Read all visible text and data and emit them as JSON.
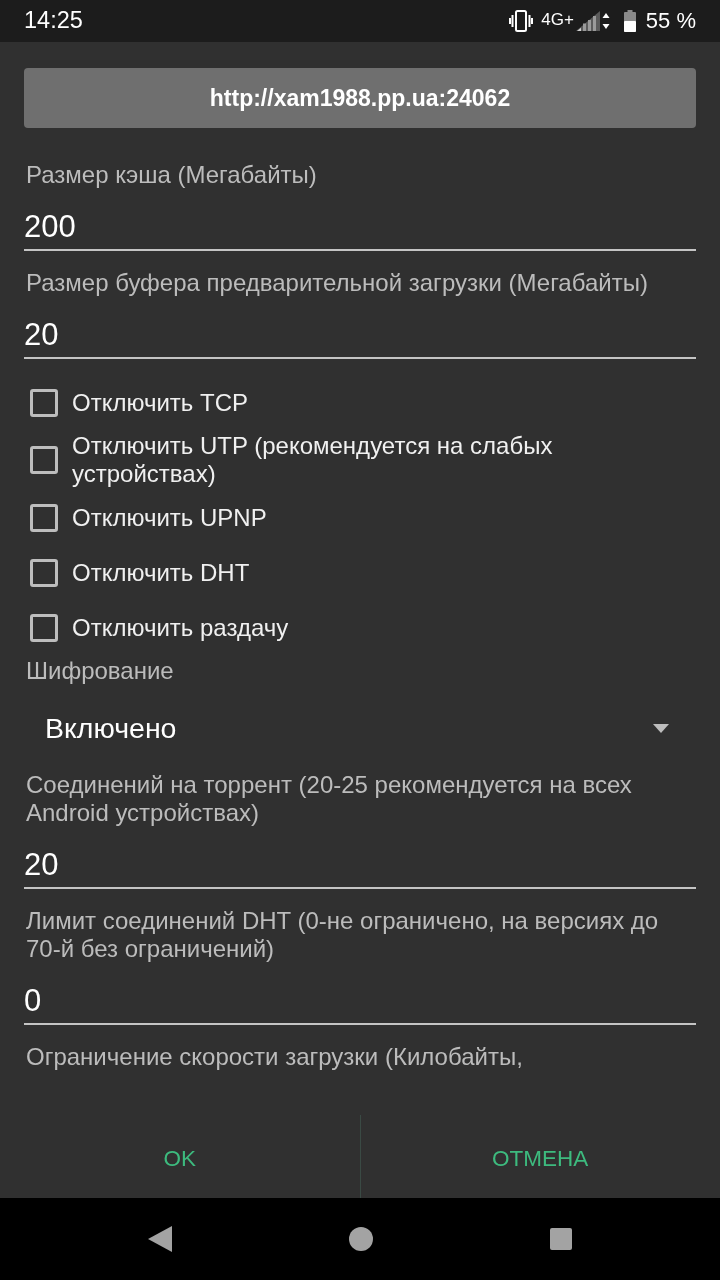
{
  "status_bar": {
    "time": "14:25",
    "network": "4G+",
    "battery": "55 %"
  },
  "server_button": {
    "label": "http://xam1988.pp.ua:24062"
  },
  "settings": [
    {
      "kind": "field",
      "label": "Размер кэша (Мегабайты)",
      "value": "200"
    },
    {
      "kind": "field",
      "label": "Размер буфера предварительной загрузки (Мегабайты)",
      "value": "20"
    },
    {
      "kind": "checkbox",
      "label": "Отключить TCP",
      "checked": false
    },
    {
      "kind": "checkbox",
      "label": "Отключить UTP (рекомендуется на слабых устройствах)",
      "checked": false
    },
    {
      "kind": "checkbox",
      "label": "Отключить UPNP",
      "checked": false
    },
    {
      "kind": "checkbox",
      "label": "Отключить DHT",
      "checked": false
    },
    {
      "kind": "checkbox",
      "label": "Отключить раздачу",
      "checked": false
    },
    {
      "kind": "select",
      "label": "Шифрование",
      "value": "Включено"
    },
    {
      "kind": "field",
      "label": "Соединений на торрент (20-25 рекомендуется на всех Android устройствах)",
      "value": "20"
    },
    {
      "kind": "field",
      "label": "Лимит соединений DHT (0-не ограничено, на версиях до 70-й без ограничений)",
      "value": "0"
    },
    {
      "kind": "caption",
      "label": "Ограничение скорости загрузки (Килобайты,"
    }
  ],
  "buttons": [
    {
      "label": "OK"
    },
    {
      "label": "ОТМЕНА"
    }
  ]
}
